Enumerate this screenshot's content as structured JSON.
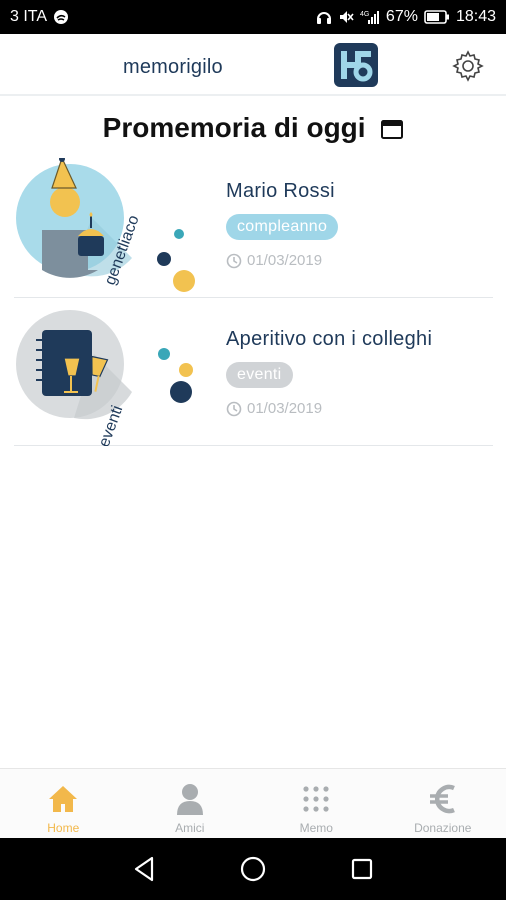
{
  "status_bar": {
    "carrier": "3 ITA",
    "battery": "67%",
    "time": "18:43"
  },
  "header": {
    "app_name": "memorigilo",
    "logo_icon": "memorigilo-logo",
    "settings_icon": "gear-icon"
  },
  "section": {
    "title": "Promemoria di oggi"
  },
  "reminders": [
    {
      "title": "Mario Rossi",
      "tag": "compleanno",
      "date": "01/03/2019",
      "category_label": "genetliaco",
      "tag_color": "#9fd6e8"
    },
    {
      "title": "Aperitivo con i colleghi",
      "tag": "eventi",
      "date": "01/03/2019",
      "category_label": "eventi",
      "tag_color": "#d0d3d6"
    }
  ],
  "bottom_nav": {
    "items": [
      {
        "label": "Home",
        "icon": "home-icon",
        "active": true
      },
      {
        "label": "Amici",
        "icon": "person-icon",
        "active": false
      },
      {
        "label": "Memo",
        "icon": "grid-icon",
        "active": false
      },
      {
        "label": "Donazione",
        "icon": "euro-icon",
        "active": false
      }
    ]
  },
  "colors": {
    "brand_navy": "#1f3a5a",
    "accent_yellow": "#f2b84b",
    "accent_blue": "#9fd6e8"
  }
}
